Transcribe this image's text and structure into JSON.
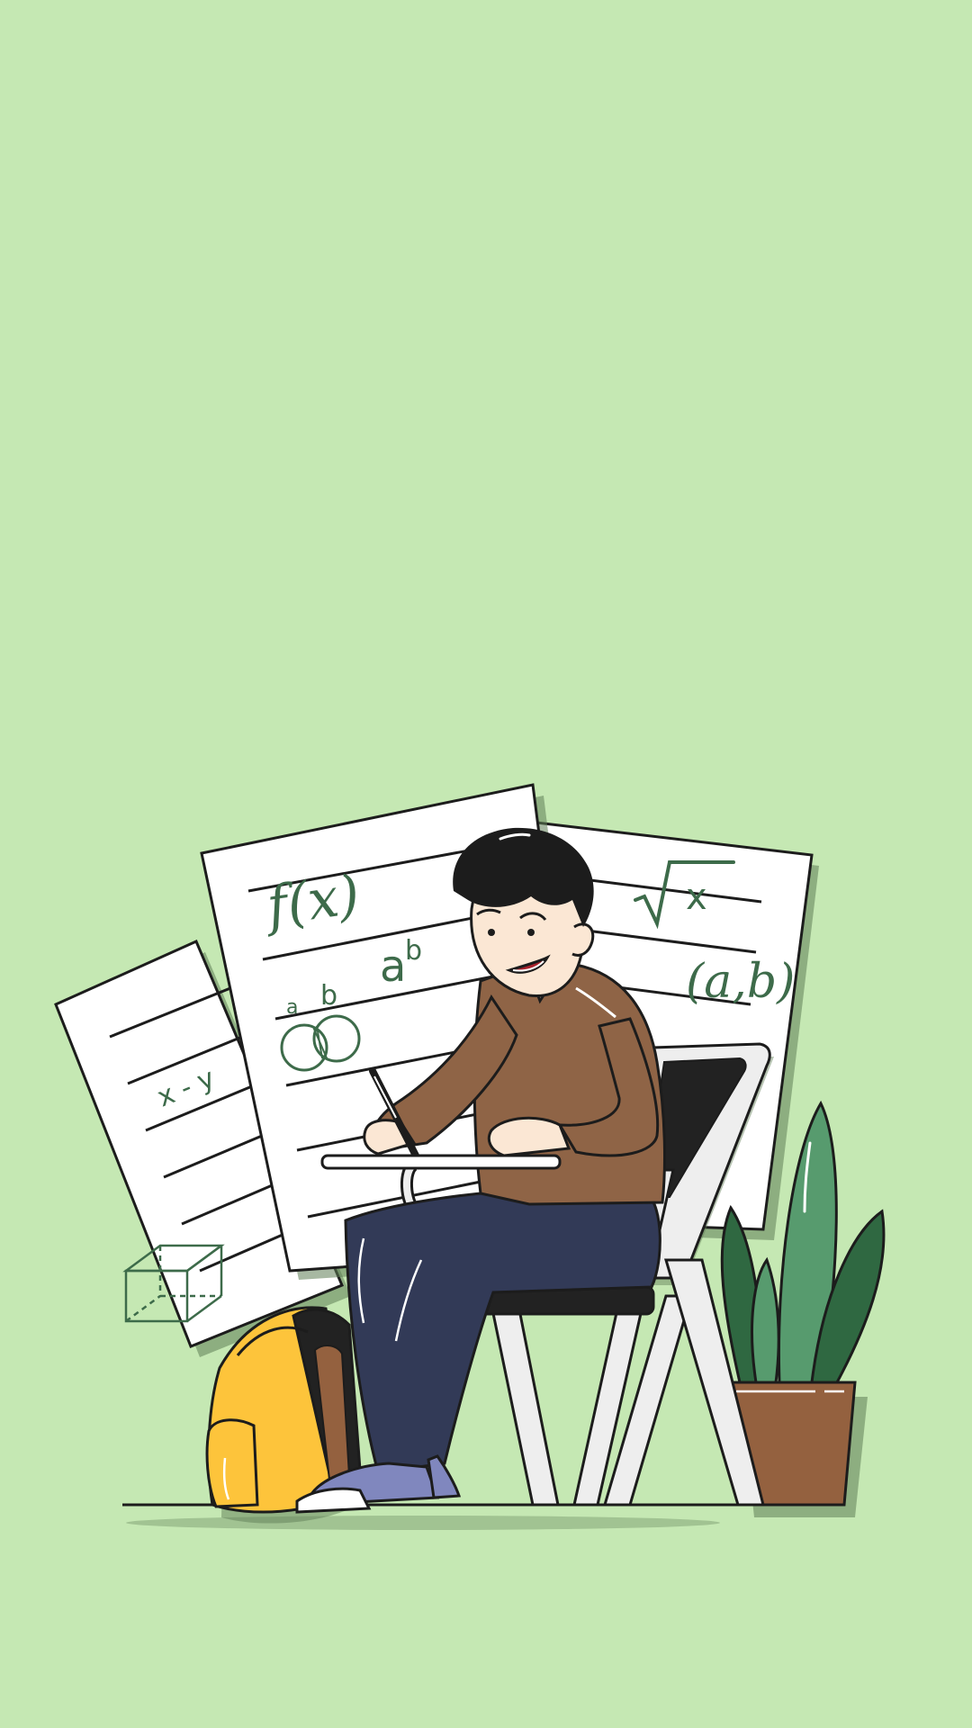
{
  "scene": {
    "description_free": true,
    "colors": {
      "background": "#c5e8b3",
      "paper": "#ffffff",
      "outline": "#1c1c1c",
      "math_ink": "#3d6b4a",
      "sweater": "#8f6446",
      "pants": "#323a57",
      "backpack": "#fdc43b",
      "plant_light": "#579b6e",
      "plant_dark": "#2f6841",
      "pot": "#94613f",
      "chair": "#eeeeee",
      "chair_back": "#222222",
      "shoe": "#8087be"
    },
    "icons": [
      "student-icon",
      "backpack-icon",
      "plant-icon",
      "chair-icon",
      "pen-icon",
      "cube-icon",
      "venn-icon"
    ]
  },
  "paper_center": {
    "formula_fx": "f(x)",
    "formula_ab_base": "a",
    "formula_ab_exp": "b",
    "venn_label_a": "a",
    "venn_label_b": "b"
  },
  "paper_right": {
    "formula_sqrt": "x",
    "formula_pair": "(a,b)"
  },
  "paper_left": {
    "formula_xy": "x - y"
  }
}
